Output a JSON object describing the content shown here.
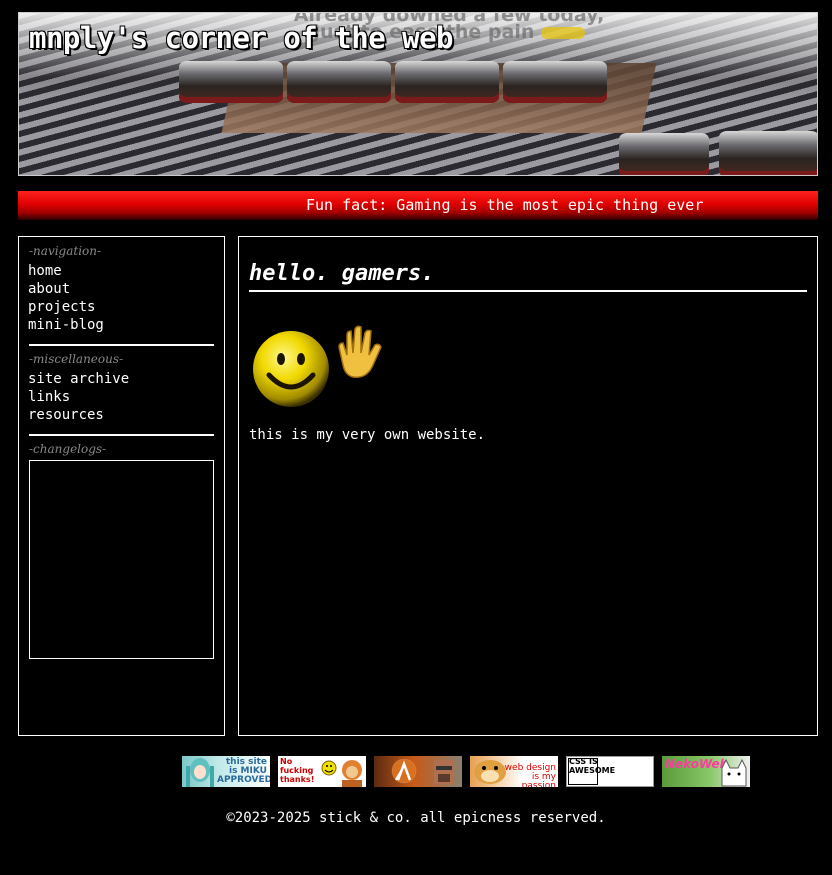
{
  "header": {
    "site_title": "mnply's corner of the web",
    "banner_caption_line1": "Already downed a few today,",
    "banner_caption_line2": "Just to ease the pain"
  },
  "funfact": {
    "text": "Fun fact: Gaming is the most epic thing ever"
  },
  "sidebar": {
    "navigation_heading": "-navigation-",
    "navigation": [
      "home",
      "about",
      "projects",
      "mini-blog"
    ],
    "misc_heading": "-miscellaneous-",
    "misc": [
      "site archive",
      "links",
      "resources"
    ],
    "changelog_heading": "-changelogs-"
  },
  "main": {
    "heading": "hello. gamers.",
    "intro": "this is my very own website."
  },
  "badges": [
    {
      "icon": "miku-badge-icon",
      "text": "this site is MIKU APPROVED"
    },
    {
      "icon": "no-thanks-badge-icon",
      "text": "No fucking thanks!"
    },
    {
      "icon": "half-life-badge-icon",
      "text": ""
    },
    {
      "icon": "web-design-badge-icon",
      "text": "web design is my passion"
    },
    {
      "icon": "css-badge-icon",
      "text": "CSS IS AWESOME"
    },
    {
      "icon": "nekoweb-badge-icon",
      "text": "NekoWeb"
    }
  ],
  "footer": {
    "text": "©2023-2025 stick & co. all epicness reserved."
  },
  "colors": {
    "background": "#000000",
    "funfact_bar": "#e00000",
    "border": "#ffffff",
    "heading_muted": "#888888"
  }
}
